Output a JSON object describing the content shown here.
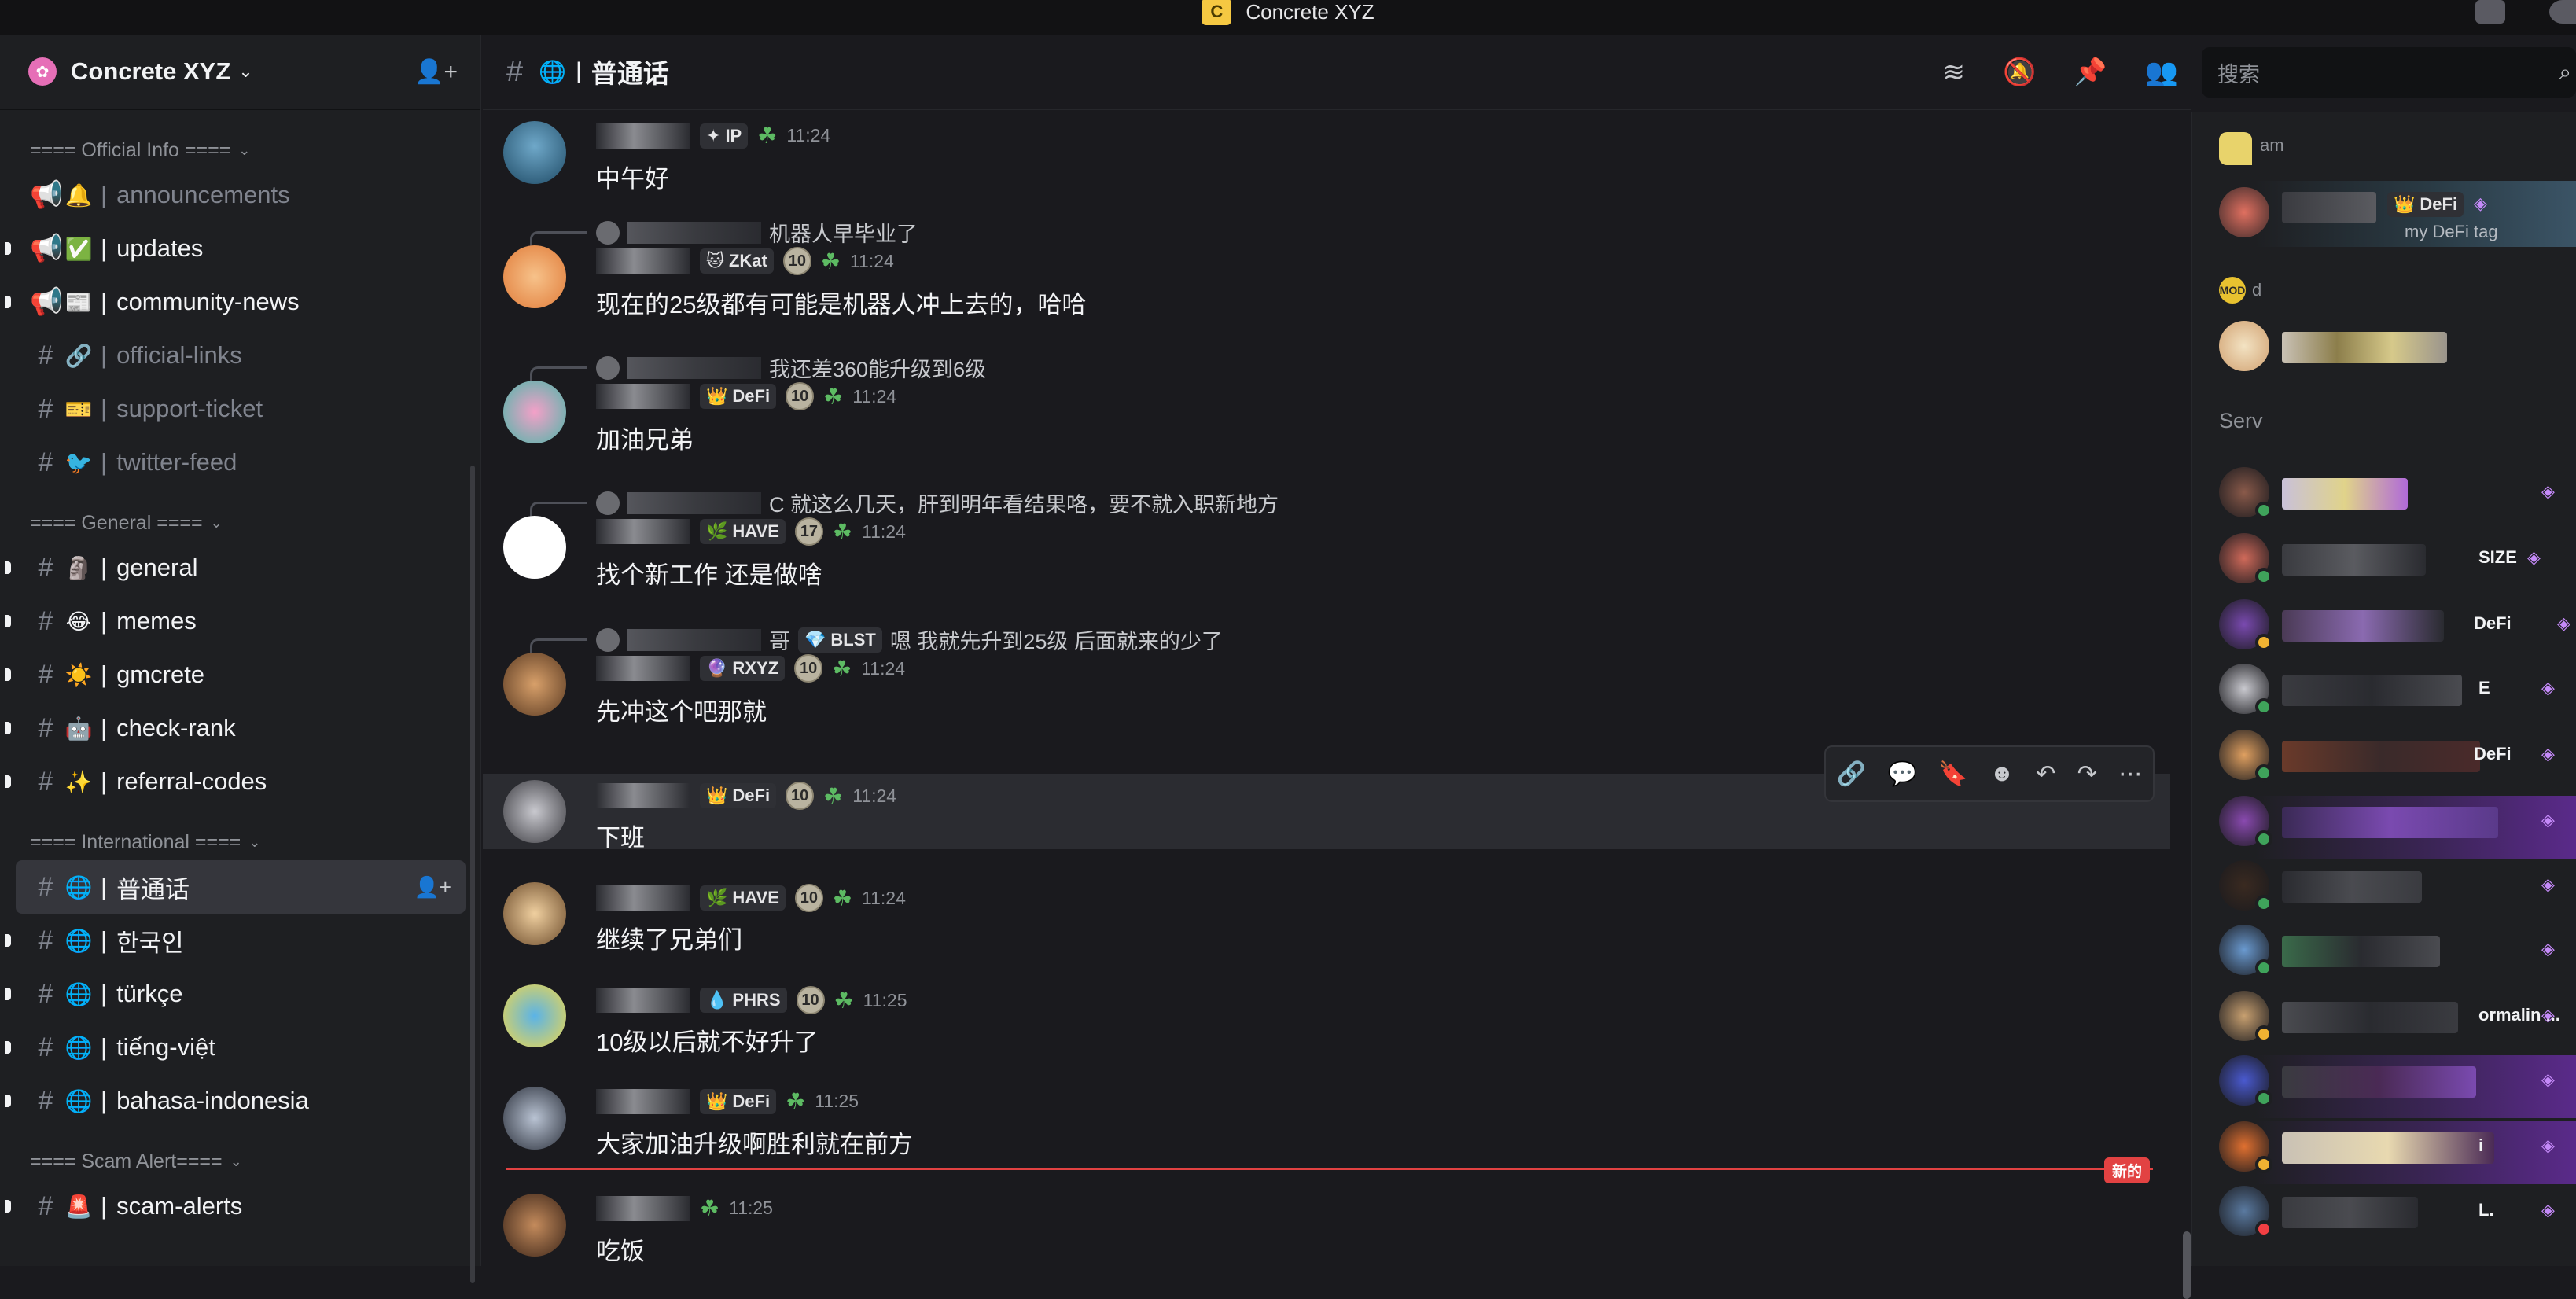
{
  "app": {
    "title": "Concrete XYZ",
    "logo_letter": "C"
  },
  "server": {
    "name": "Concrete XYZ"
  },
  "categories": [
    {
      "label": "==== Official Info ===="
    },
    {
      "label": "==== General ===="
    },
    {
      "label": "==== International ===="
    },
    {
      "label": "==== Scam Alert===="
    }
  ],
  "channels": [
    {
      "emoji": "🔔",
      "name": "announcements",
      "muted": true
    },
    {
      "emoji": "✅",
      "name": "updates"
    },
    {
      "emoji": "📰",
      "name": "community-news"
    },
    {
      "emoji": "🔗",
      "name": "official-links",
      "muted": true
    },
    {
      "emoji": "🎫",
      "name": "support-ticket",
      "muted": true
    },
    {
      "emoji": "🐦",
      "name": "twitter-feed",
      "muted": true
    },
    {
      "emoji": "🗿",
      "name": "general"
    },
    {
      "emoji": "😂",
      "name": "memes"
    },
    {
      "emoji": "☀️",
      "name": "gmcrete"
    },
    {
      "emoji": "🤖",
      "name": "check-rank"
    },
    {
      "emoji": "✨",
      "name": "referral-codes"
    },
    {
      "emoji": "🌐",
      "name": "普通话"
    },
    {
      "emoji": "🌐",
      "name": "한국인"
    },
    {
      "emoji": "🌐",
      "name": "türkçe"
    },
    {
      "emoji": "🌐",
      "name": "tiếng-việt"
    },
    {
      "emoji": "🌐",
      "name": "bahasa-indonesia"
    },
    {
      "emoji": "🚨",
      "name": "scam-alerts"
    }
  ],
  "current_channel": {
    "name": "普通话"
  },
  "search": {
    "placeholder": "搜索"
  },
  "messages": [
    {
      "tag": "IP",
      "time": "11:24",
      "content": "中午好"
    },
    {
      "reply": "机器人早毕业了",
      "tag": "ZKat",
      "level": "10",
      "time": "11:24",
      "content": "现在的25级都有可能是机器人冲上去的，哈哈"
    },
    {
      "reply": "我还差360能升级到6级",
      "tag": "DeFi",
      "level": "10",
      "time": "11:24",
      "content": "加油兄弟"
    },
    {
      "reply": "C 就这么几天，肝到明年看结果咯，要不就入职新地方",
      "tag": "HAVE",
      "level": "17",
      "time": "11:24",
      "content": "找个新工作 还是做啥"
    },
    {
      "reply": "哥",
      "reply_tag": "BLST",
      "reply_text": "嗯 我就先升到25级 后面就来的少了",
      "tag": "RXYZ",
      "level": "10",
      "time": "11:24",
      "content": "先冲这个吧那就"
    },
    {
      "tag": "DeFi",
      "level": "10",
      "time": "11:24",
      "content": "下班"
    },
    {
      "tag": "HAVE",
      "level": "10",
      "time": "11:24",
      "content": "继续了兄弟们"
    },
    {
      "tag": "PHRS",
      "level": "10",
      "time": "11:25",
      "content": "10级以后就不好升了"
    },
    {
      "tag": "DeFi",
      "time": "11:25",
      "content": "大家加油升级啊胜利就在前方"
    },
    {
      "time": "11:25",
      "content": "吃饭"
    }
  ],
  "new_badge": "新的",
  "members": {
    "top_partial": "am",
    "top_tag": "DeFi",
    "top_tag_sub": "my DeFi tag",
    "mod_label": "MOD",
    "section_servers": "Serv",
    "rows": [
      {
        "tag": ""
      },
      {
        "tag": "SIZE"
      },
      {
        "tag": "DeFi"
      },
      {
        "tag": "E"
      },
      {
        "tag": "DeFi"
      },
      {
        "tag": ""
      },
      {
        "tag": ""
      },
      {
        "tag": ""
      },
      {
        "tag": "ormalin ..."
      },
      {
        "tag": ""
      },
      {
        "tag": "i"
      },
      {
        "tag": "L."
      }
    ]
  },
  "colors": {
    "accent_red": "#e24242",
    "clover_green": "#5dbb63",
    "gem_purple": "#c58af9"
  }
}
